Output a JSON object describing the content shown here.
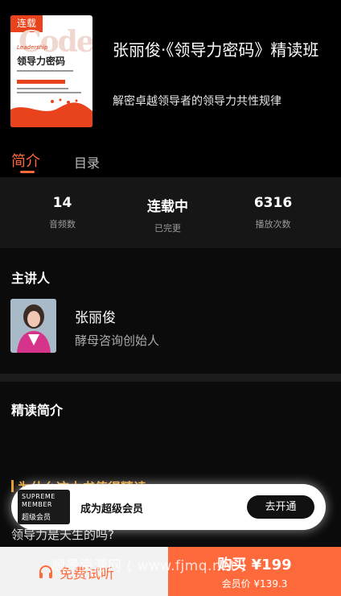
{
  "course": {
    "cover_tag": "连载",
    "cover_big_word": "Code",
    "cover_sub_word": "Leadership",
    "cover_title": "领导力密码",
    "title": "张丽俊·《领导力密码》精读班",
    "subtitle": "解密卓越领导者的领导力共性规律"
  },
  "tabs": [
    {
      "label": "简介",
      "active": true
    },
    {
      "label": "目录",
      "active": false
    }
  ],
  "stats": [
    {
      "value": "14",
      "label": "音频数"
    },
    {
      "value": "连载中",
      "label": "已完更"
    },
    {
      "value": "6316",
      "label": "播放次数"
    }
  ],
  "lecturer": {
    "heading": "主讲人",
    "name": "张丽俊",
    "role": "酵母咨询创始人"
  },
  "intro": {
    "heading": "精读简介",
    "question_heading": "为什么这本书值得精读",
    "question_text": "领导力是天生的吗?"
  },
  "member_popup": {
    "badge_line1": "SUPREME",
    "badge_line2": "MEMBER",
    "badge_cn": "超级会员",
    "text": "成为超级会员",
    "button": "去开通"
  },
  "bottom_bar": {
    "trial_label": "免费试听",
    "buy_label": "购买 ¥199",
    "member_price": "会员价 ¥139.3"
  },
  "watermark": "顺景资源网 ( www.fjmq.net )",
  "colors": {
    "accent": "#ff6a3c",
    "gold": "#e49a2a",
    "background": "#000000"
  },
  "icons": {
    "trial": "headphone-icon"
  }
}
